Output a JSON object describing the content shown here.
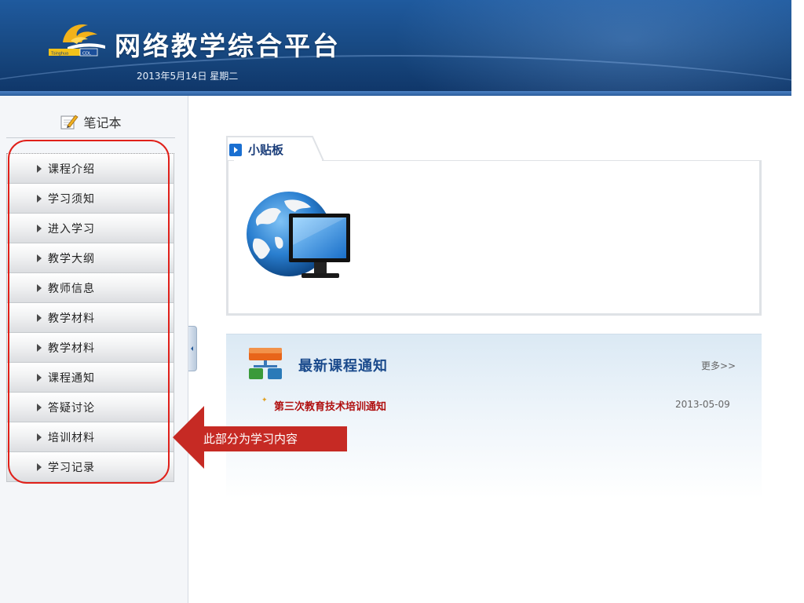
{
  "header": {
    "title": "网络教学综合平台",
    "date": "2013年5月14日 星期二",
    "logo_icon": "tsinghua-cdl-logo-icon"
  },
  "sidebar": {
    "notebook_label": "笔记本",
    "notebook_icon": "notebook-pencil-icon",
    "items": [
      {
        "label": "课程介绍"
      },
      {
        "label": "学习须知"
      },
      {
        "label": "进入学习"
      },
      {
        "label": "教学大纲"
      },
      {
        "label": "教师信息"
      },
      {
        "label": "教学材料"
      },
      {
        "label": "教学材料"
      },
      {
        "label": "课程通知"
      },
      {
        "label": "答疑讨论"
      },
      {
        "label": "培训材料"
      },
      {
        "label": "学习记录"
      }
    ]
  },
  "bulletin": {
    "title": "小贴板",
    "image_icon": "globe-monitor-icon"
  },
  "notices": {
    "title": "最新课程通知",
    "more_label": "更多>>",
    "items": [
      {
        "title": "第三次教育技术培训通知",
        "date": "2013-05-09"
      }
    ]
  },
  "callout": {
    "text": "此部分为学习内容"
  },
  "colors": {
    "header_blue": "#17477f",
    "accent_red": "#e0201a",
    "notice_red": "#b01010",
    "callout_red": "#c62a24"
  }
}
